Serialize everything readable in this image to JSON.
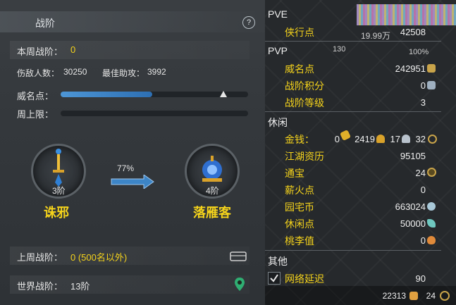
{
  "left": {
    "header_title": "战阶",
    "help": "?",
    "week_rank_label": "本周战阶：",
    "week_rank_value": "0",
    "kills_label": "伤敌人数：",
    "kills_value": "30250",
    "assist_label": "最佳助攻：",
    "assist_value": "3992",
    "prestige_label": "威名点：",
    "prestige_fill": 0.49,
    "week_limit_label": "周上限：",
    "week_limit_fill": 0.0,
    "emblem_left_tier": "3阶",
    "emblem_left_name": "诛邪",
    "progress_percent": "77%",
    "emblem_right_tier": "4阶",
    "emblem_right_name": "落雁客",
    "last_week_label": "上周战阶：",
    "last_week_value": "0 (500名以外)",
    "world_rank_label": "世界战阶：",
    "world_rank_value": "13阶"
  },
  "right": {
    "pve": {
      "title": "PVE",
      "label": "侠行点",
      "value": "42508"
    },
    "pvp": {
      "title": "PVP",
      "items": [
        {
          "label": "威名点",
          "value": "242951"
        },
        {
          "label": "战阶积分",
          "value": "0"
        },
        {
          "label": "战阶等级",
          "value": "3"
        }
      ]
    },
    "leisure": {
      "title": "休闲",
      "money": {
        "label": "金钱：",
        "gold": "0",
        "silver": "2419",
        "copper1": "17",
        "copper2": "32"
      },
      "items": [
        {
          "label": "江湖资历",
          "value": "95105"
        },
        {
          "label": "通宝",
          "value": "24"
        },
        {
          "label": "薪火点",
          "value": "0"
        },
        {
          "label": "园宅币",
          "value": "663024"
        },
        {
          "label": "休闲点",
          "value": "50000"
        },
        {
          "label": "桃李值",
          "value": "0"
        }
      ]
    },
    "other": {
      "title": "其他",
      "latency_label": "网络延迟",
      "latency_value": "90",
      "latency_checked": true
    },
    "footer": {
      "value1": "22313",
      "value2": "24"
    },
    "background_overlay": {
      "bar1": "19.99万",
      "bar2": "130",
      "bar3": "100%"
    }
  },
  "colors": {
    "accent_yellow": "#f5d31b",
    "bar_blue": "#3d85c6",
    "text": "#e8e8e8"
  }
}
